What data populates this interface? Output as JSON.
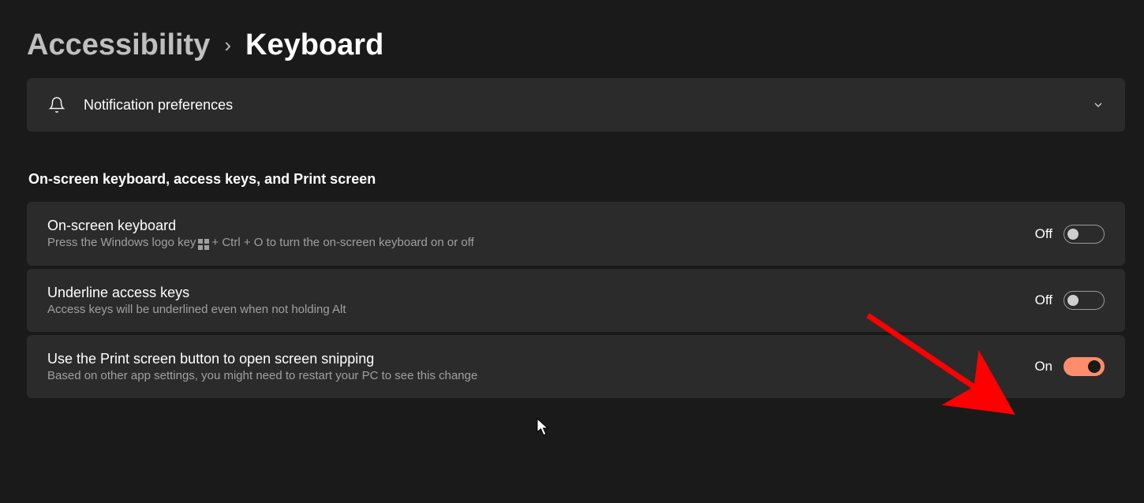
{
  "breadcrumb": {
    "parent": "Accessibility",
    "current": "Keyboard"
  },
  "notification_card": {
    "label": "Notification preferences"
  },
  "section_heading": "On-screen keyboard, access keys, and Print screen",
  "settings": {
    "osk": {
      "title": "On-screen keyboard",
      "sub_pre": "Press the Windows logo key",
      "sub_post": "+ Ctrl + O to turn the on-screen keyboard on or off",
      "state": "Off"
    },
    "underline": {
      "title": "Underline access keys",
      "sub": "Access keys will be underlined even when not holding Alt",
      "state": "Off"
    },
    "printscreen": {
      "title": "Use the Print screen button to open screen snipping",
      "sub": "Based on other app settings, you might need to restart your PC to see this change",
      "state": "On"
    }
  },
  "colors": {
    "accent_on": "#ff8c6b"
  }
}
